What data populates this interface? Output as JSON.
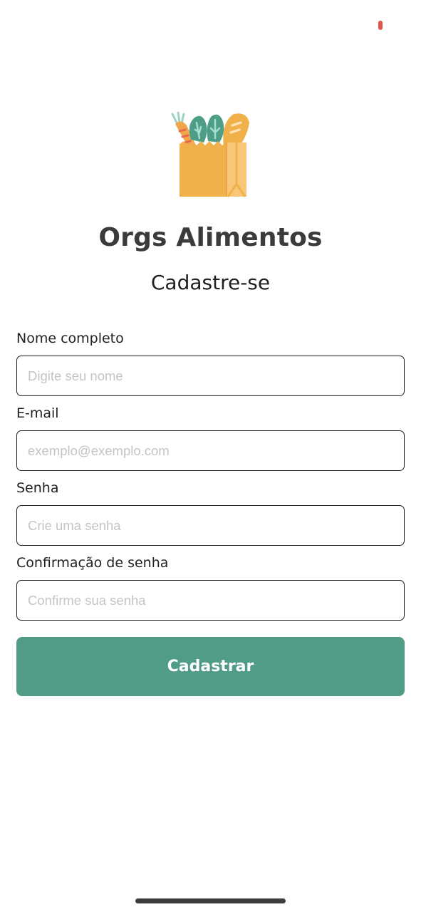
{
  "app": {
    "title": "Orgs Alimentos",
    "subtitle": "Cadastre-se"
  },
  "logo": {
    "icon": "grocery-bag-icon"
  },
  "form": {
    "name": {
      "label": "Nome completo",
      "placeholder": "Digite seu nome",
      "value": ""
    },
    "email": {
      "label": "E-mail",
      "placeholder": "exemplo@exemplo.com",
      "value": ""
    },
    "password": {
      "label": "Senha",
      "placeholder": "Crie uma senha",
      "value": ""
    },
    "confirm": {
      "label": "Confirmação de senha",
      "placeholder": "Confirme sua senha",
      "value": ""
    },
    "submit_label": "Cadastrar"
  },
  "colors": {
    "primary": "#519c86",
    "bag": "#f0b04a",
    "text": "#3b3b3b",
    "status_indicator": "#e0554a"
  }
}
